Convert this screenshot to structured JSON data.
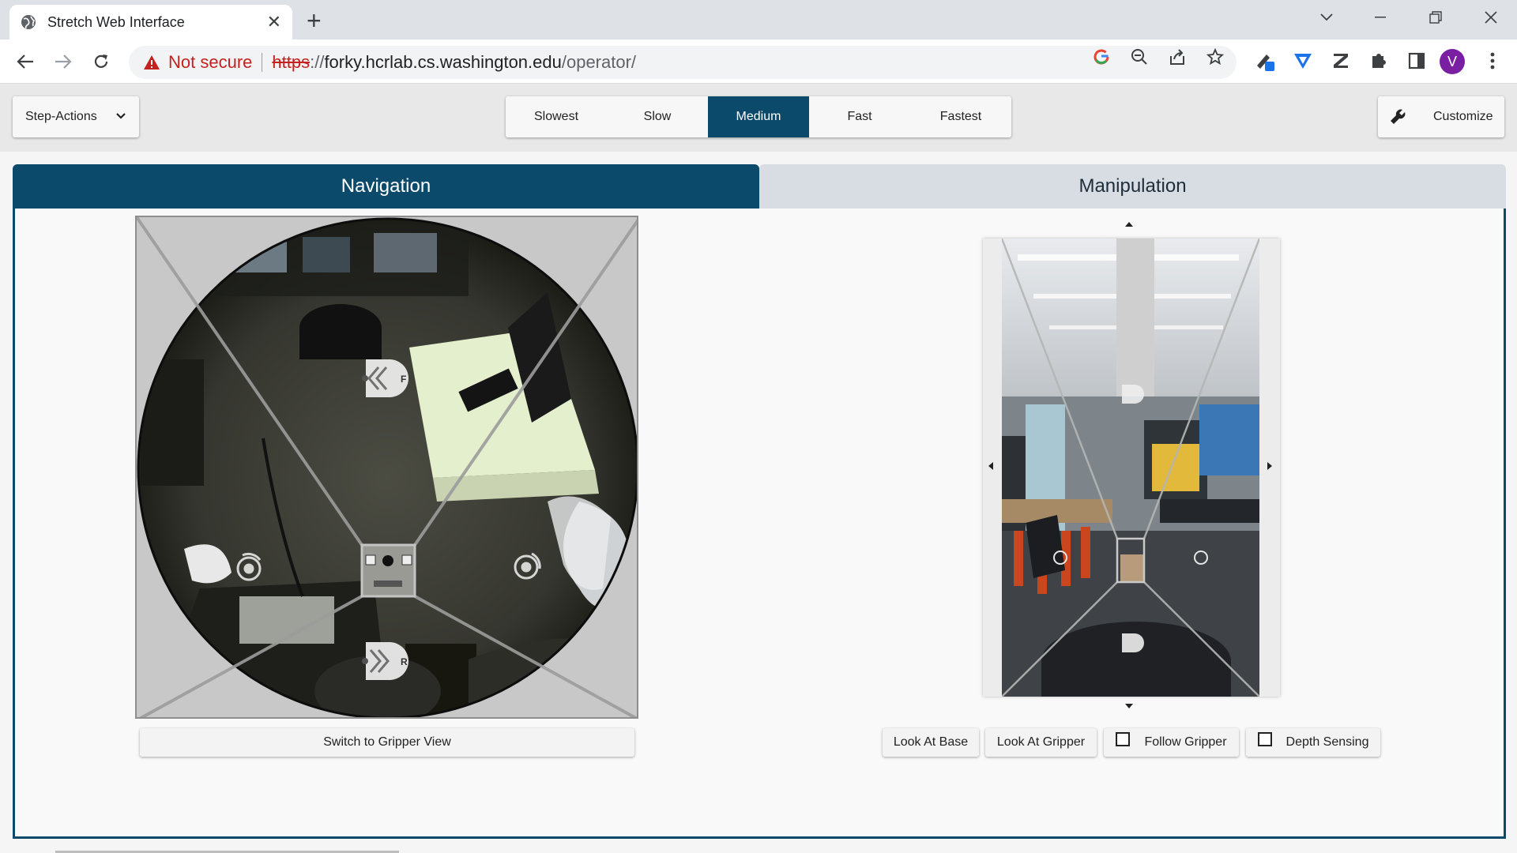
{
  "browser": {
    "tab_title": "Stretch Web Interface",
    "omnibox": {
      "security": "Not secure",
      "scheme": "https",
      "separator": "://",
      "host": "forky.hcrlab.cs.washington.edu",
      "path": "/operator/"
    },
    "profile_initial": "V"
  },
  "header": {
    "step_actions": "Step-Actions",
    "speeds": [
      "Slowest",
      "Slow",
      "Medium",
      "Fast",
      "Fastest"
    ],
    "selected_speed": "Medium",
    "customize": "Customize"
  },
  "mode_tabs": [
    "Navigation",
    "Manipulation"
  ],
  "active_tab": "Navigation",
  "nav_camera": {
    "forward_label": "F",
    "reverse_label": "R",
    "switch_button": "Switch to Gripper View"
  },
  "head_camera": {
    "buttons": {
      "look_at_base": "Look At Base",
      "look_at_gripper": "Look At Gripper",
      "follow_gripper": "Follow Gripper",
      "depth_sensing": "Depth Sensing"
    },
    "follow_gripper_checked": false,
    "depth_sensing_checked": false
  },
  "colors": {
    "accent": "#0b4a6b",
    "tab_inactive": "#d7dde3",
    "not_secure": "#c5221f",
    "profile": "#7b1fa2"
  }
}
